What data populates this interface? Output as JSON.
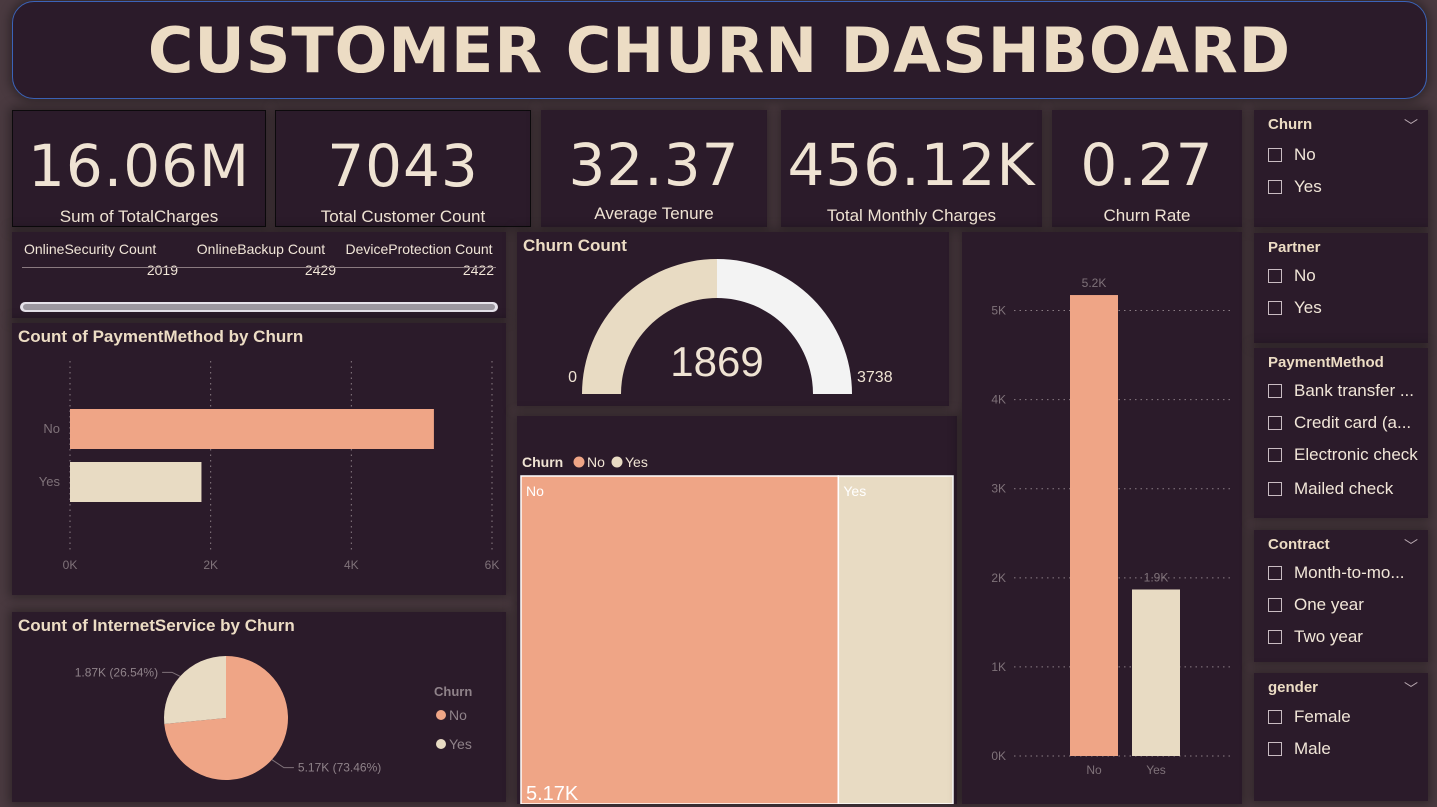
{
  "title": "CUSTOMER CHURN DASHBOARD",
  "colors": {
    "no": "#efa586",
    "yes": "#e8dbc3",
    "panel": "#2b1b2a",
    "gauge_rest": "#f3f3f3"
  },
  "kpis": [
    {
      "value": "16.06M",
      "label": "Sum of TotalCharges"
    },
    {
      "value": "7043",
      "label": "Total Customer Count"
    },
    {
      "value": "32.37",
      "label": "Average Tenure"
    },
    {
      "value": "456.12K",
      "label": "Total Monthly Charges"
    },
    {
      "value": "0.27",
      "label": "Churn Rate"
    }
  ],
  "service_table": {
    "headers": [
      "OnlineSecurity Count",
      "OnlineBackup Count",
      "DeviceProtection Count"
    ],
    "values": [
      "2019",
      "2429",
      "2422"
    ]
  },
  "payment_chart": {
    "title": "Count of PaymentMethod by Churn",
    "chart_data": {
      "type": "bar",
      "orientation": "horizontal",
      "categories": [
        "No",
        "Yes"
      ],
      "values": [
        5174,
        1869
      ],
      "xlim": [
        0,
        6000
      ],
      "ticks": [
        "0K",
        "2K",
        "4K",
        "6K"
      ],
      "grid": true
    }
  },
  "gauge": {
    "title": "Churn Count",
    "value": "1869",
    "min": "0",
    "max": "3738",
    "fraction": 0.5
  },
  "treemap": {
    "legend_title": "Churn",
    "legend_items": [
      "No",
      "Yes"
    ],
    "cells": [
      {
        "label": "No",
        "value_label": "5.17K",
        "value": 5174
      },
      {
        "label": "Yes",
        "value_label": "",
        "value": 1869
      }
    ]
  },
  "vbar": {
    "chart_data": {
      "type": "bar",
      "categories": [
        "No",
        "Yes"
      ],
      "values": [
        5174,
        1869
      ],
      "data_labels": [
        "5.2K",
        "1.9K"
      ],
      "ylim": [
        0,
        5500
      ],
      "ticks": [
        "0K",
        "1K",
        "2K",
        "3K",
        "4K",
        "5K"
      ],
      "grid": true
    }
  },
  "pie": {
    "title": "Count of InternetService by Churn",
    "legend_title": "Churn",
    "legend_items": [
      "No",
      "Yes"
    ],
    "chart_data": {
      "type": "pie",
      "labels": [
        "No",
        "Yes"
      ],
      "values": [
        5174,
        1869
      ],
      "data_labels": [
        "5.17K (73.46%)",
        "1.87K (26.54%)"
      ]
    }
  },
  "slicers": [
    {
      "title": "Churn",
      "options": [
        "No",
        "Yes"
      ]
    },
    {
      "title": "Partner",
      "options": [
        "No",
        "Yes"
      ]
    },
    {
      "title": "PaymentMethod",
      "options": [
        "Bank transfer ...",
        "Credit card (a...",
        "Electronic check",
        "Mailed check"
      ]
    },
    {
      "title": "Contract",
      "options": [
        "Month-to-mo...",
        "One year",
        "Two year"
      ]
    },
    {
      "title": "gender",
      "options": [
        "Female",
        "Male"
      ]
    }
  ]
}
